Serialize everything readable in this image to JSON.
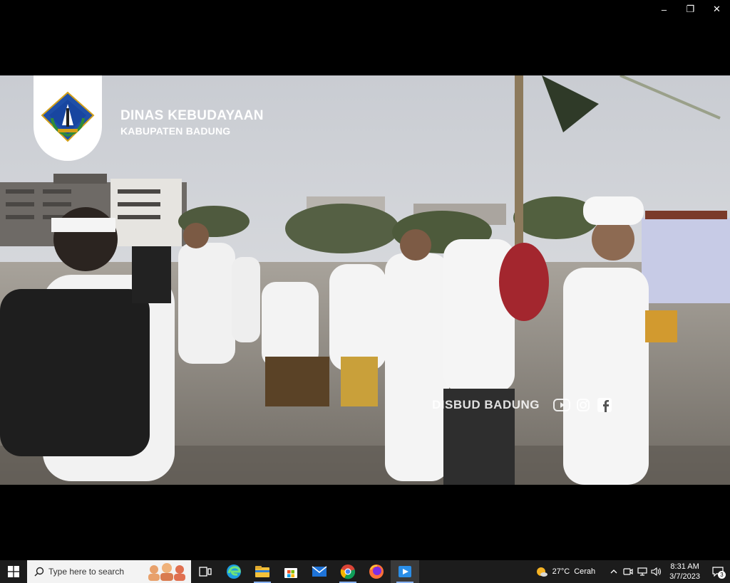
{
  "window": {
    "controls": {
      "minimize": "–",
      "maximize": "❐",
      "close": "✕"
    }
  },
  "video": {
    "brand_title": "DINAS KEBUDAYAAN",
    "brand_subtitle": "KABUPATEN BADUNG",
    "watermark": "DISBUD BADUNG",
    "social_icons": [
      "youtube-icon",
      "instagram-icon",
      "facebook-icon"
    ]
  },
  "taskbar": {
    "search_placeholder": "Type here to search",
    "apps": [
      "task-view-icon",
      "edge-icon",
      "file-explorer-icon",
      "microsoft-store-icon",
      "mail-icon",
      "chrome-icon",
      "firefox-icon",
      "media-player-icon"
    ],
    "weather_temp": "27°C",
    "weather_desc": "Cerah",
    "time": "8:31 AM",
    "date": "3/7/2023",
    "notification_count": "3"
  },
  "colors": {
    "taskbar": "#1c1c1c",
    "accent": "#8ab4f8",
    "logo_blue": "#1f4fa8"
  }
}
